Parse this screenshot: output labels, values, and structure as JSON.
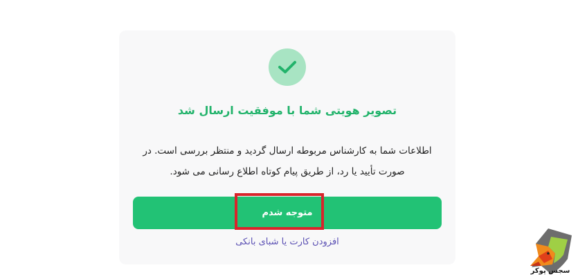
{
  "dialog": {
    "title": "تصویر هویتی شما با موفقیت ارسال شد",
    "message_line1": "اطلاعات شما به کارشناس مربوطه ارسال گردید و منتظر بررسی است. در",
    "message_line2": "صورت تأیید یا رد، از طریق پیام کوتاه اطلاع رسانی می شود.",
    "confirm_label": "متوجه شدم",
    "bank_link_label": "افزودن کارت یا شبای بانکی"
  },
  "watermark": {
    "text": "سجس پوکر"
  },
  "icons": {
    "success": "check-icon",
    "logo": "fox-logo-icon"
  },
  "colors": {
    "accent": "#22c275",
    "title": "#22b36b",
    "check_bg": "#a8e4c3",
    "link": "#5a4fb3",
    "highlight": "#d9242b",
    "card_bg": "#f8f8f9"
  }
}
